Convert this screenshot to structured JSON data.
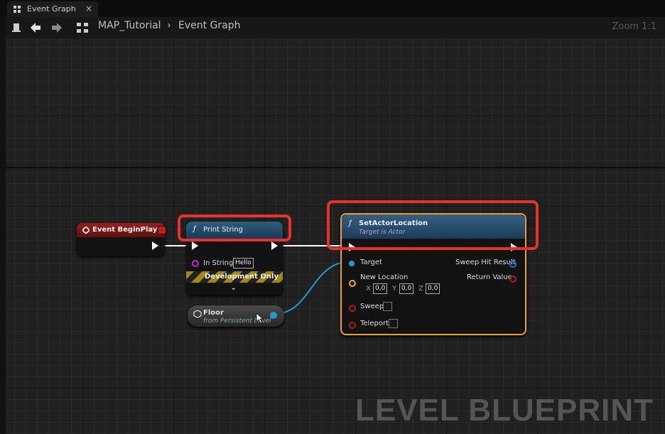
{
  "tab": {
    "label": "Event Graph",
    "close": "×"
  },
  "toolbar": {
    "breadcrumb_root": "MAP_Tutorial",
    "breadcrumb_sep": "›",
    "breadcrumb_current": "Event Graph",
    "zoom": "Zoom 1:1"
  },
  "nodes": {
    "begin_play": {
      "title": "Event BeginPlay"
    },
    "print_string": {
      "title": "Print String",
      "in_string_label": "In String",
      "in_string_value": "Hello",
      "dev_only": "Development Only",
      "expand": "⌄"
    },
    "floor": {
      "title": "Floor",
      "subtitle": "from Persistent Level"
    },
    "set_actor_location": {
      "title": "SetActorLocation",
      "subtitle": "Target is Actor",
      "target": "Target",
      "new_location": "New Location",
      "x_label": "X",
      "x_value": "0,0",
      "y_label": "Y",
      "y_value": "0,0",
      "z_label": "Z",
      "z_value": "0,0",
      "sweep": "Sweep",
      "teleport": "Teleport",
      "sweep_hit_result": "Sweep Hit Result",
      "return_value": "Return Value"
    }
  },
  "watermark": "LEVEL BLUEPRINT",
  "colors": {
    "highlight": "#e8302c",
    "selected_border": "#f0a020",
    "exec_wire": "#ffffff",
    "object_wire": "#1e9ad6"
  }
}
